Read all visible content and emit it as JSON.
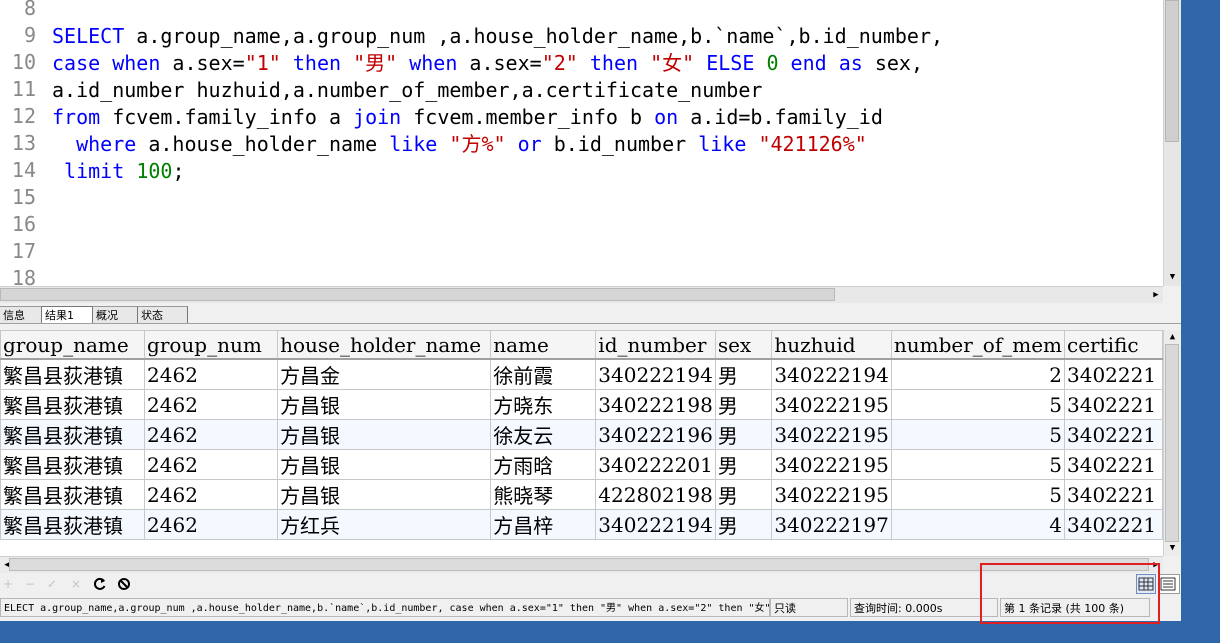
{
  "editor": {
    "line_numbers": [
      "8",
      "9",
      "10",
      "11",
      "12",
      "13",
      "14",
      "15",
      "16",
      "17",
      "18"
    ]
  },
  "tabs": [
    "信息",
    "结果1",
    "概况",
    "状态"
  ],
  "grid": {
    "columns": [
      "group_name",
      "group_num",
      "house_holder_name",
      "name",
      "id_number",
      "sex",
      "huzhuid",
      "number_of_mem",
      "certific"
    ],
    "rows": [
      [
        "繁昌县荻港镇",
        "2462",
        "方昌金",
        "徐前霞",
        "340222194",
        "男",
        "340222194",
        "2",
        "3402221"
      ],
      [
        "繁昌县荻港镇",
        "2462",
        "方昌银",
        "方晓东",
        "340222198",
        "男",
        "340222195",
        "5",
        "3402221"
      ],
      [
        "繁昌县荻港镇",
        "2462",
        "方昌银",
        "徐友云",
        "340222196",
        "男",
        "340222195",
        "5",
        "3402221"
      ],
      [
        "繁昌县荻港镇",
        "2462",
        "方昌银",
        "方雨晗",
        "340222201",
        "男",
        "340222195",
        "5",
        "3402221"
      ],
      [
        "繁昌县荻港镇",
        "2462",
        "方昌银",
        "熊晓琴",
        "422802198",
        "男",
        "340222195",
        "5",
        "3402221"
      ],
      [
        "繁昌县荻港镇",
        "2462",
        "方红兵",
        "方昌梓",
        "340222194",
        "男",
        "340222197",
        "4",
        "3402221"
      ]
    ]
  },
  "status": {
    "sql": "ELECT a.group_name,a.group_num ,a.house_holder_name,b.`name`,b.id_number, case when a.sex=\"1\" then \"男\" when a.sex=\"2\" then \"女\"",
    "mode": "只读",
    "query_time": "查询时间: 0.000s",
    "record": "第 1 条记录 (共 100 条)"
  },
  "colors": {
    "keyword": "#0000ff",
    "string": "#c00000",
    "number": "#008000",
    "desktop": "#2f67a8",
    "highlight_box": "#e02020"
  }
}
